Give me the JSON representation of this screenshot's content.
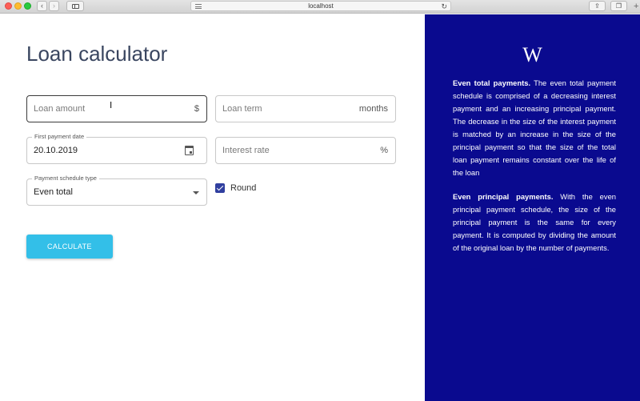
{
  "browser": {
    "url": "localhost",
    "back_glyph": "‹",
    "forward_glyph": "›",
    "reload_glyph": "↻",
    "share_glyph": "⇪",
    "tabs_glyph": "❐",
    "new_tab_glyph": "+"
  },
  "page": {
    "title": "Loan calculator"
  },
  "form": {
    "loan_amount": {
      "placeholder": "Loan amount",
      "suffix": "$"
    },
    "loan_term": {
      "placeholder": "Loan term",
      "suffix": "months"
    },
    "first_payment_date": {
      "label": "First payment date",
      "value": "20.10.2019"
    },
    "interest_rate": {
      "placeholder": "Interest rate",
      "suffix": "%"
    },
    "payment_schedule_type": {
      "label": "Payment schedule type",
      "value": "Even total"
    },
    "round": {
      "label": "Round",
      "checked": true
    },
    "calculate_label": "CALCULATE"
  },
  "info": {
    "logo": "W",
    "even_total_title": "Even total payments.",
    "even_total_text": " The even total payment schedule is comprised of a decreasing interest payment and an increasing principal payment. The decrease in the size of the interest payment is matched by an increase in the size of the principal payment so that the size of the total loan payment remains constant over the life of the loan",
    "even_principal_title": "Even principal payments.",
    "even_principal_text": " With the even principal payment schedule, the size of the principal payment is the same for every payment. It is computed by dividing the amount of the original loan by the number of payments."
  },
  "colors": {
    "panel_bg": "#0a0a8f",
    "button_bg": "#33bfe8",
    "checkbox": "#303f9f",
    "title": "#3a4660"
  }
}
